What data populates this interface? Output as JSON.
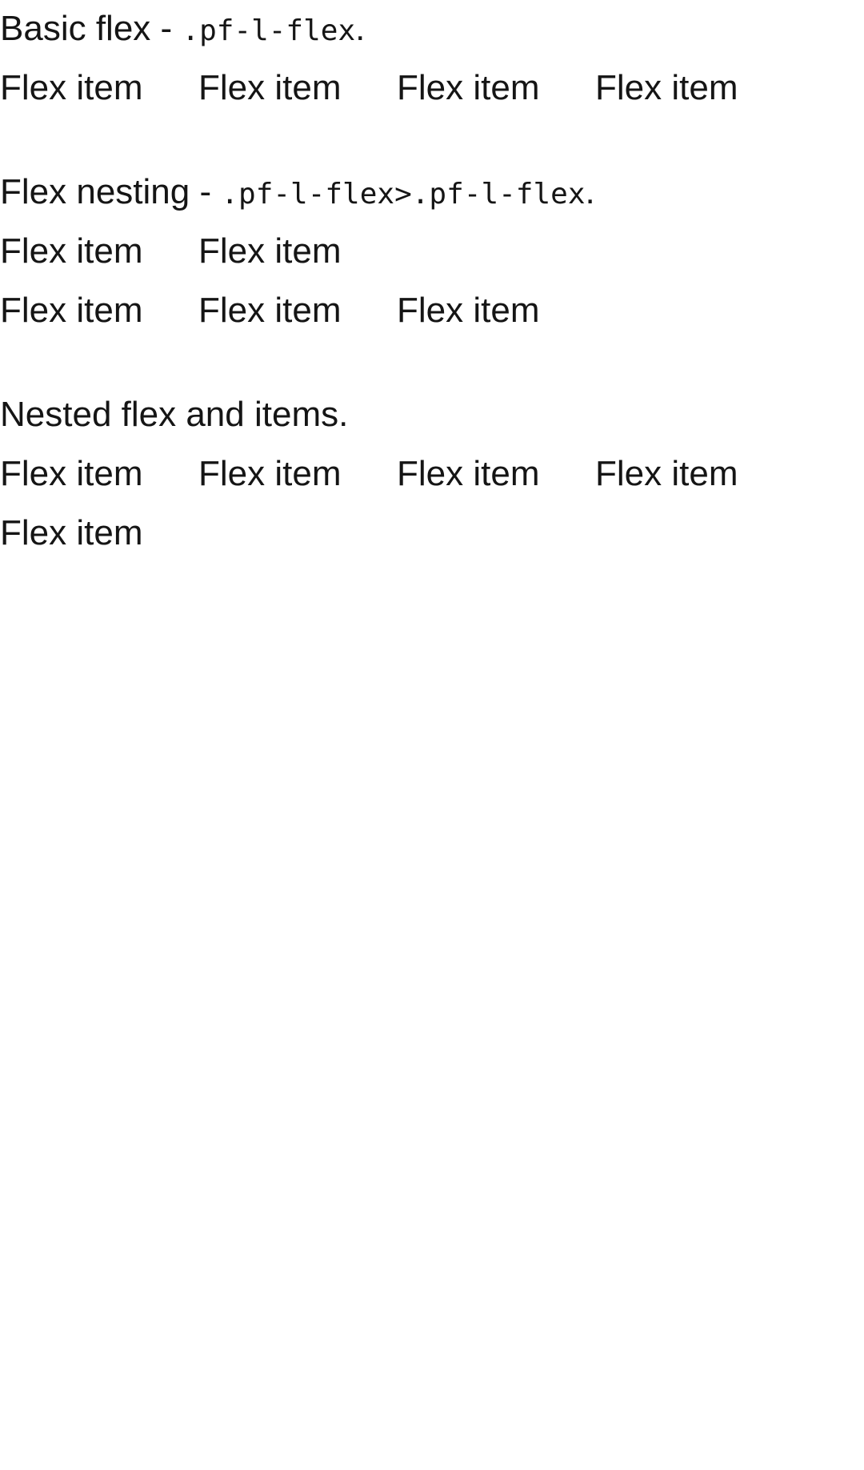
{
  "sections": [
    {
      "desc_prefix": "Basic flex - ",
      "desc_code": ".pf-l-flex",
      "desc_suffix": ".",
      "rows": [
        [
          "Flex item",
          "Flex item",
          "Flex item",
          "Flex item"
        ]
      ]
    },
    {
      "desc_prefix": "Flex nesting - ",
      "desc_code": ".pf-l-flex>.pf-l-flex",
      "desc_suffix": ".",
      "rows": [
        [
          "Flex item",
          "Flex item"
        ],
        [
          "Flex item",
          "Flex item",
          "Flex item"
        ]
      ]
    },
    {
      "desc_prefix": "Nested flex and items.",
      "desc_code": "",
      "desc_suffix": "",
      "rows": [
        [
          "Flex item",
          "Flex item",
          "Flex item",
          "Flex item"
        ],
        [
          "Flex item"
        ]
      ]
    }
  ]
}
